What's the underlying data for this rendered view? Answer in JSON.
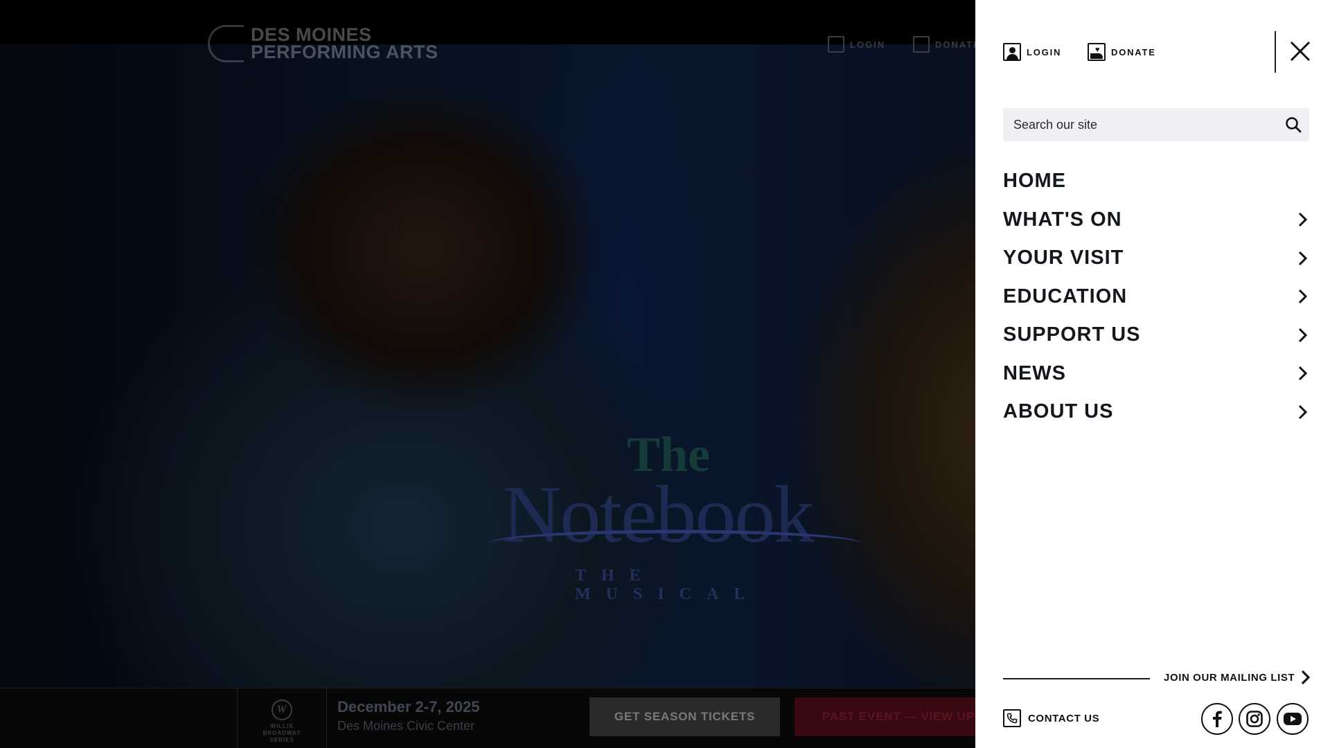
{
  "background": {
    "show": {
      "title_top": "The",
      "title_main": "Notebook",
      "subtitle": "THE MUSICAL"
    },
    "logo_text": {
      "line1": "DES MOINES",
      "line2": "PERFORMING ARTS"
    },
    "utility": {
      "login": "LOGIN",
      "donate": "DONATE"
    },
    "bottom_bar": {
      "series_text": "WILLIS BROADWAY SERIES",
      "date": "December 2-7, 2025",
      "venue": "Des Moines Civic Center",
      "season_button": "GET SEASON TICKETS",
      "past_button": "PAST EVENT — VIEW UPCOMING"
    }
  },
  "drawer": {
    "login_label": "LOGIN",
    "donate_label": "DONATE",
    "search": {
      "placeholder": "Search our site"
    },
    "nav": [
      {
        "label": "HOME",
        "has_submenu": false
      },
      {
        "label": "WHAT'S ON",
        "has_submenu": true
      },
      {
        "label": "YOUR VISIT",
        "has_submenu": true
      },
      {
        "label": "EDUCATION",
        "has_submenu": true
      },
      {
        "label": "SUPPORT US",
        "has_submenu": true
      },
      {
        "label": "NEWS",
        "has_submenu": true
      },
      {
        "label": "ABOUT US",
        "has_submenu": true
      }
    ],
    "mailing_list_label": "JOIN OUR MAILING LIST",
    "contact_label": "CONTACT US",
    "social": [
      "facebook-icon",
      "instagram-icon",
      "youtube-icon"
    ]
  },
  "colors": {
    "drawer_bg": "#ffffff",
    "nav_text": "#14171c",
    "search_bg": "#eef0f3",
    "past_event_button": "#3a0910"
  }
}
